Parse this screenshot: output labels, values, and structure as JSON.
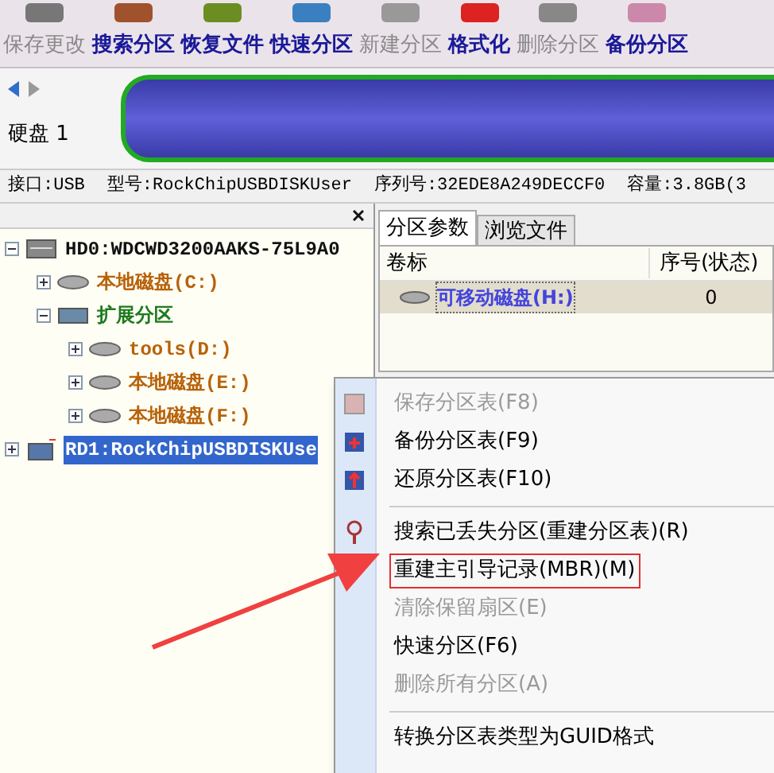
{
  "toolbar": [
    {
      "label": "保存更改",
      "disabled": true
    },
    {
      "label": "搜索分区",
      "disabled": false
    },
    {
      "label": "恢复文件",
      "disabled": false
    },
    {
      "label": "快速分区",
      "disabled": false
    },
    {
      "label": "新建分区",
      "disabled": true
    },
    {
      "label": "格式化",
      "disabled": false
    },
    {
      "label": "删除分区",
      "disabled": true
    },
    {
      "label": "备份分区",
      "disabled": false
    }
  ],
  "disk_label": "硬盘 1",
  "info": [
    "接口:USB",
    "型号:RockChipUSBDISKUser",
    "序列号:32EDE8A249DECCF0",
    "容量:3.8GB(3"
  ],
  "tree": [
    {
      "label": "HD0:WDCWD3200AAKS-75L9A0",
      "kind": "disk",
      "expanded": true,
      "selected": false,
      "children": [
        {
          "label": "本地磁盘(C:)",
          "kind": "partition",
          "expanded": false,
          "selected": false,
          "color": "#b8620a"
        },
        {
          "label": "扩展分区",
          "kind": "extended",
          "expanded": true,
          "selected": false,
          "color": "#1f7a1f",
          "children": [
            {
              "label": "tools(D:)",
              "kind": "partition",
              "expanded": false,
              "selected": false,
              "color": "#b8620a"
            },
            {
              "label": "本地磁盘(E:)",
              "kind": "partition",
              "expanded": false,
              "selected": false,
              "color": "#b8620a"
            },
            {
              "label": "本地磁盘(F:)",
              "kind": "partition",
              "expanded": false,
              "selected": false,
              "color": "#b8620a"
            }
          ]
        }
      ]
    },
    {
      "label": "RD1:RockChipUSBDISKUse",
      "kind": "usb",
      "expanded": false,
      "selected": true
    }
  ],
  "tabs": [
    {
      "label": "分区参数",
      "selected": true
    },
    {
      "label": "浏览文件",
      "selected": false
    }
  ],
  "table": {
    "columns": [
      "卷标",
      "序号(状态)"
    ],
    "rows": [
      {
        "cells": [
          "可移动磁盘(H:)",
          "0"
        ],
        "selected": true
      }
    ]
  },
  "menu": [
    {
      "kind": "item",
      "label": "保存分区表(F8)",
      "disabled": true,
      "boxed": false
    },
    {
      "kind": "item",
      "label": "备份分区表(F9)",
      "disabled": false,
      "boxed": false
    },
    {
      "kind": "item",
      "label": "还原分区表(F10)",
      "disabled": false,
      "boxed": false
    },
    {
      "kind": "separator"
    },
    {
      "kind": "item",
      "label": "搜索已丢失分区(重建分区表)(R)",
      "disabled": false,
      "boxed": false
    },
    {
      "kind": "item",
      "label": "重建主引导记录(MBR)(M)",
      "disabled": false,
      "boxed": true
    },
    {
      "kind": "item",
      "label": "清除保留扇区(E)",
      "disabled": true,
      "boxed": false
    },
    {
      "kind": "item",
      "label": "快速分区(F6)",
      "disabled": false,
      "boxed": false
    },
    {
      "kind": "item",
      "label": "删除所有分区(A)",
      "disabled": true,
      "boxed": false
    },
    {
      "kind": "separator"
    },
    {
      "kind": "item",
      "label": "转换分区表类型为GUID格式",
      "disabled": false,
      "boxed": false
    }
  ]
}
